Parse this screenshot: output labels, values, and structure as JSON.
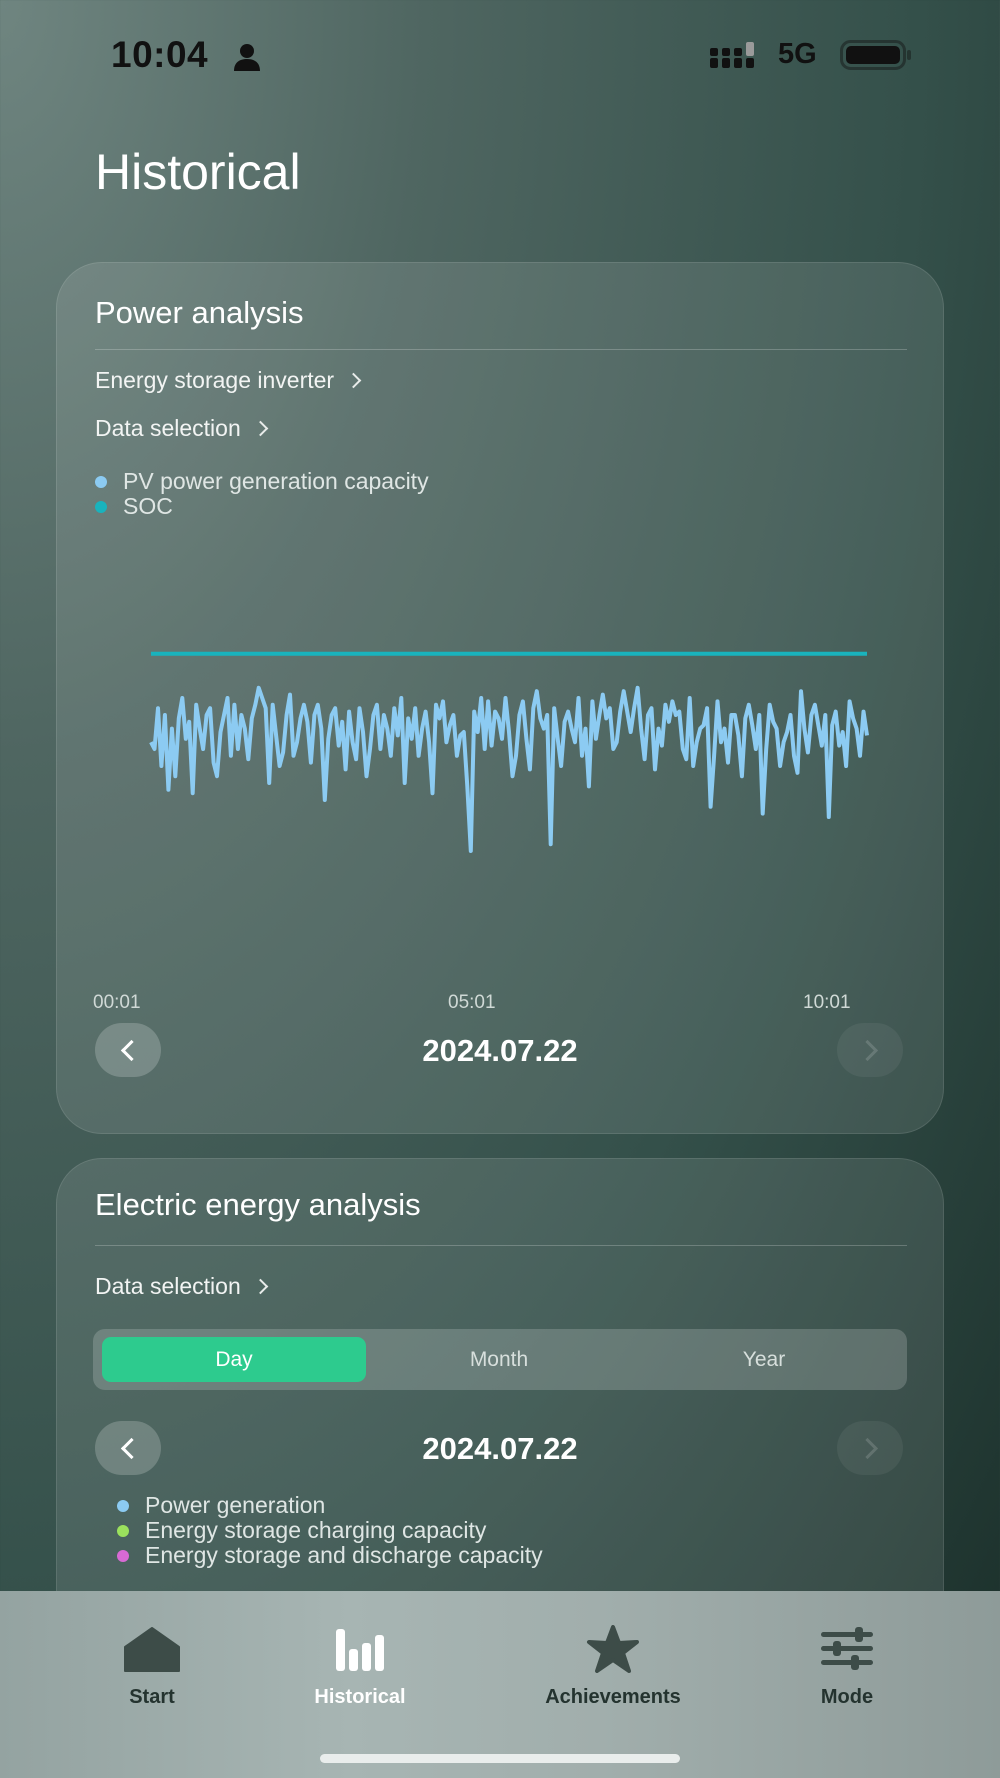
{
  "status_bar": {
    "time": "10:04",
    "network": "5G"
  },
  "page_title": "Historical",
  "power_card": {
    "title": "Power analysis",
    "device_link": "Energy storage inverter",
    "data_selection": "Data selection",
    "legend": [
      {
        "label": "PV power generation capacity",
        "color": "#8ccbf2"
      },
      {
        "label": "SOC",
        "color": "#19b3bd"
      }
    ],
    "date": "2024.07.22"
  },
  "energy_card": {
    "title": "Electric energy analysis",
    "data_selection": "Data selection",
    "tabs": [
      "Day",
      "Month",
      "Year"
    ],
    "active_tab": "Day",
    "date": "2024.07.22",
    "legend": [
      {
        "label": "Power generation",
        "color": "#8ccbf2"
      },
      {
        "label": "Energy storage charging capacity",
        "color": "#9be15d"
      },
      {
        "label": "Energy storage and discharge capacity",
        "color": "#d86ad4"
      }
    ]
  },
  "tab_bar": {
    "items": [
      {
        "label": "Start",
        "icon": "home-icon"
      },
      {
        "label": "Historical",
        "icon": "bar-chart-icon",
        "active": true
      },
      {
        "label": "Achievements",
        "icon": "star-icon"
      },
      {
        "label": "Mode",
        "icon": "sliders-icon"
      }
    ]
  },
  "chart_data": {
    "type": "line",
    "x_tick_labels": [
      "00:01",
      "05:01",
      "10:01"
    ],
    "grid": false,
    "legend_position": "top-left",
    "series": [
      {
        "name": "PV power generation capacity",
        "color": "#8ccbf2",
        "values": [
          62,
          60,
          72,
          55,
          70,
          48,
          66,
          52,
          69,
          75,
          63,
          68,
          47,
          73,
          66,
          60,
          70,
          72,
          56,
          52,
          65,
          70,
          75,
          58,
          73,
          60,
          70,
          66,
          57,
          69,
          73,
          78,
          75,
          72,
          50,
          73,
          64,
          55,
          59,
          70,
          76,
          58,
          62,
          69,
          73,
          68,
          56,
          70,
          73,
          66,
          45,
          63,
          70,
          72,
          61,
          68,
          54,
          71,
          62,
          57,
          72,
          65,
          52,
          60,
          70,
          73,
          60,
          70,
          66,
          58,
          72,
          64,
          75,
          50,
          69,
          63,
          72,
          58,
          66,
          71,
          62,
          47,
          73,
          69,
          74,
          62,
          67,
          70,
          58,
          64,
          65,
          49,
          30,
          71,
          65,
          75,
          60,
          74,
          61,
          71,
          69,
          63,
          75,
          65,
          52,
          58,
          70,
          74,
          63,
          54,
          72,
          77,
          69,
          66,
          70,
          32,
          72,
          63,
          55,
          68,
          71,
          66,
          62,
          75,
          58,
          66,
          49,
          74,
          63,
          70,
          76,
          69,
          72,
          60,
          62,
          71,
          77,
          71,
          65,
          72,
          78,
          66,
          57,
          70,
          72,
          54,
          66,
          61,
          73,
          68,
          74,
          70,
          71,
          60,
          57,
          75,
          55,
          62,
          66,
          67,
          72,
          43,
          58,
          74,
          62,
          66,
          56,
          70,
          70,
          64,
          52,
          69,
          73,
          67,
          60,
          70,
          41,
          60,
          73,
          68,
          66,
          55,
          62,
          65,
          70,
          58,
          53,
          77,
          66,
          59,
          70,
          73,
          67,
          61,
          70,
          40,
          67,
          71,
          61,
          65,
          55,
          74,
          69,
          66,
          58,
          71,
          64
        ]
      },
      {
        "name": "SOC",
        "color": "#19b3bd",
        "values": [
          88,
          88,
          88,
          88,
          88,
          88,
          88,
          88,
          88,
          88,
          88,
          88,
          88,
          88,
          88,
          88,
          88,
          88,
          88,
          88,
          88,
          88,
          88,
          88,
          88,
          88,
          88,
          88,
          88,
          88,
          88,
          88,
          88,
          88,
          88,
          88,
          88,
          88,
          88,
          88,
          88,
          88,
          88,
          88,
          88,
          88,
          88,
          88,
          88,
          88,
          88,
          88,
          88,
          88,
          88,
          88,
          88,
          88,
          88,
          88,
          88,
          88,
          88,
          88,
          88,
          88,
          88,
          88,
          88,
          88,
          88,
          88,
          88,
          88,
          88,
          88,
          88,
          88,
          88,
          88,
          88,
          88,
          88,
          88,
          88,
          88,
          88,
          88,
          88,
          88,
          88,
          88,
          88,
          88,
          88,
          88,
          88,
          88,
          88,
          88,
          88,
          88,
          88,
          88,
          88,
          88,
          88,
          88,
          88,
          88,
          88,
          88,
          88,
          88,
          88,
          88,
          88,
          88,
          88,
          88,
          88,
          88,
          88,
          88,
          88,
          88,
          88,
          88,
          88,
          88,
          88,
          88,
          88,
          88,
          88,
          88,
          88,
          88,
          88,
          88,
          88,
          88,
          88,
          88,
          88,
          88,
          88,
          88,
          88,
          88,
          88,
          88,
          88,
          88,
          88,
          88,
          88,
          88,
          88,
          88,
          88,
          88,
          88,
          88,
          88,
          88,
          88,
          88,
          88,
          88,
          88,
          88,
          88,
          88,
          88,
          88,
          88,
          88,
          88,
          88,
          88,
          88,
          88,
          88,
          88,
          88,
          88,
          88,
          88,
          88,
          88,
          88,
          88,
          88,
          88,
          88,
          88,
          88,
          88,
          88,
          88,
          88,
          88,
          88,
          88,
          88,
          88,
          88,
          88,
          88,
          88
        ]
      }
    ],
    "ylim": [
      0,
      100
    ]
  }
}
